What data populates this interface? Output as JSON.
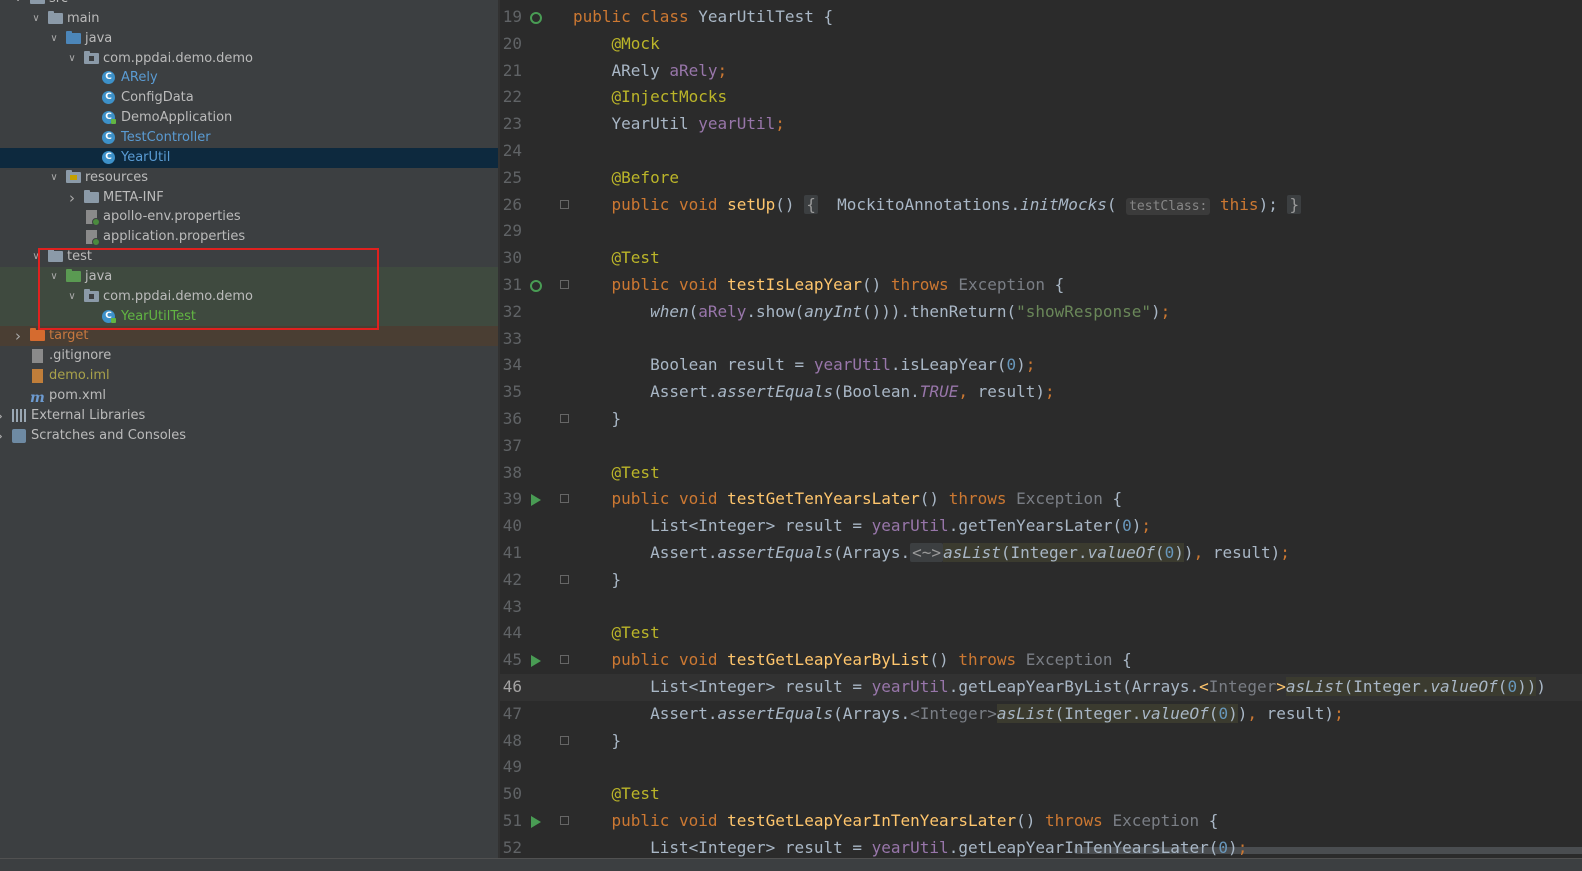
{
  "project_tree": {
    "items": [
      {
        "label": "src",
        "depth": 2,
        "icon": "folder-icon",
        "expanded": true,
        "style": ""
      },
      {
        "label": "main",
        "depth": 3,
        "icon": "folder-icon",
        "expanded": true,
        "style": ""
      },
      {
        "label": "java",
        "depth": 4,
        "icon": "source-folder-icon",
        "expanded": true,
        "style": ""
      },
      {
        "label": "com.ppdai.demo.demo",
        "depth": 5,
        "icon": "package-icon",
        "expanded": true,
        "style": ""
      },
      {
        "label": "ARely",
        "depth": 6,
        "icon": "class-icon",
        "style": "blue"
      },
      {
        "label": "ConfigData",
        "depth": 6,
        "icon": "class-icon",
        "style": ""
      },
      {
        "label": "DemoApplication",
        "depth": 6,
        "icon": "runnable-class-icon",
        "style": ""
      },
      {
        "label": "TestController",
        "depth": 6,
        "icon": "class-icon",
        "style": "blue"
      },
      {
        "label": "YearUtil",
        "depth": 6,
        "icon": "class-icon",
        "style": "blue",
        "selected": true
      },
      {
        "label": "resources",
        "depth": 4,
        "icon": "resources-folder-icon",
        "expanded": true,
        "style": ""
      },
      {
        "label": "META-INF",
        "depth": 5,
        "icon": "folder-icon",
        "expanded": false,
        "style": ""
      },
      {
        "label": "apollo-env.properties",
        "depth": 5,
        "icon": "properties-file-icon",
        "style": ""
      },
      {
        "label": "application.properties",
        "depth": 5,
        "icon": "properties-file-icon",
        "style": ""
      },
      {
        "label": "test",
        "depth": 3,
        "icon": "folder-icon",
        "expanded": true,
        "style": ""
      },
      {
        "label": "java",
        "depth": 4,
        "icon": "test-source-folder-icon",
        "expanded": true,
        "style": "",
        "test": true
      },
      {
        "label": "com.ppdai.demo.demo",
        "depth": 5,
        "icon": "package-icon",
        "expanded": true,
        "style": "",
        "test": true
      },
      {
        "label": "YearUtilTest",
        "depth": 6,
        "icon": "runnable-class-icon",
        "style": "grn",
        "test": true
      },
      {
        "label": "target",
        "depth": 2,
        "icon": "excluded-folder-icon",
        "expanded": false,
        "style": "org",
        "target": true
      },
      {
        "label": ".gitignore",
        "depth": 2,
        "icon": "file-icon",
        "style": ""
      },
      {
        "label": "demo.iml",
        "depth": 2,
        "icon": "iml-file-icon",
        "style": "yel"
      },
      {
        "label": "pom.xml",
        "depth": 2,
        "icon": "maven-icon",
        "style": ""
      },
      {
        "label": "External Libraries",
        "depth": 1,
        "icon": "libraries-icon",
        "expanded": false,
        "style": ""
      },
      {
        "label": "Scratches and Consoles",
        "depth": 1,
        "icon": "scratches-icon",
        "expanded": false,
        "style": ""
      }
    ]
  },
  "editor": {
    "current_line": "46",
    "lines": [
      {
        "n": "19",
        "gutter": "run-class",
        "segs": [
          [
            "k",
            "public class "
          ],
          [
            "",
            "YearUtilTest {"
          ]
        ]
      },
      {
        "n": "20",
        "segs": [
          [
            "",
            "    "
          ],
          [
            "a",
            "@Mock"
          ]
        ]
      },
      {
        "n": "21",
        "segs": [
          [
            "",
            "    ARely "
          ],
          [
            "f",
            "aRely"
          ],
          [
            "k",
            ";"
          ]
        ]
      },
      {
        "n": "22",
        "segs": [
          [
            "",
            "    "
          ],
          [
            "a",
            "@InjectMocks"
          ]
        ]
      },
      {
        "n": "23",
        "segs": [
          [
            "",
            "    YearUtil "
          ],
          [
            "f",
            "yearUtil"
          ],
          [
            "k",
            ";"
          ]
        ]
      },
      {
        "n": "24",
        "segs": []
      },
      {
        "n": "25",
        "segs": [
          [
            "",
            "    "
          ],
          [
            "a",
            "@Before"
          ]
        ]
      },
      {
        "n": "26",
        "fold": true,
        "segs": [
          [
            "",
            "    "
          ],
          [
            "k",
            "public void "
          ],
          [
            "fn",
            "setUp"
          ],
          [
            "",
            "() "
          ],
          [
            "fl",
            "{"
          ],
          [
            "",
            "  MockitoAnnotations."
          ],
          [
            "i",
            "initMocks"
          ],
          [
            "",
            "( "
          ],
          [
            "hint",
            "testClass:"
          ],
          [
            "k",
            " this"
          ],
          [
            "",
            "); "
          ],
          [
            "fl",
            "}"
          ]
        ]
      },
      {
        "n": "29",
        "segs": []
      },
      {
        "n": "30",
        "segs": [
          [
            "",
            "    "
          ],
          [
            "a",
            "@Test"
          ]
        ]
      },
      {
        "n": "31",
        "gutter": "run-class",
        "fold": true,
        "segs": [
          [
            "",
            "    "
          ],
          [
            "k",
            "public void "
          ],
          [
            "fn",
            "testIsLeapYear"
          ],
          [
            "",
            "() "
          ],
          [
            "k",
            "throws "
          ],
          [
            "mt",
            "Exception"
          ],
          [
            "",
            ""
          ],
          [
            "",
            ""
          ],
          [
            "",
            " {"
          ]
        ]
      },
      {
        "n": "32",
        "segs": [
          [
            "",
            "        "
          ],
          [
            "i",
            "when"
          ],
          [
            "",
            "("
          ],
          [
            "f",
            "aRely"
          ],
          [
            "",
            ".show("
          ],
          [
            "i",
            "anyInt"
          ],
          [
            "",
            "())).thenReturn("
          ],
          [
            "s",
            "\"showResponse\""
          ],
          [
            "",
            ")"
          ],
          [
            "k",
            ";"
          ]
        ]
      },
      {
        "n": "33",
        "segs": []
      },
      {
        "n": "34",
        "segs": [
          [
            "",
            "        Boolean result = "
          ],
          [
            "f",
            "yearUtil"
          ],
          [
            "",
            ".isLeapYear("
          ],
          [
            "n",
            "0"
          ],
          [
            "",
            ")"
          ],
          [
            "k",
            ";"
          ]
        ]
      },
      {
        "n": "35",
        "segs": [
          [
            "",
            "        Assert."
          ],
          [
            "i",
            "assertEquals"
          ],
          [
            "",
            "(Boolean."
          ],
          [
            "ic",
            "TRUE"
          ],
          [
            "k",
            ", "
          ],
          [
            "",
            "result)"
          ],
          [
            "k",
            ";"
          ]
        ]
      },
      {
        "n": "36",
        "fold": true,
        "segs": [
          [
            "",
            "    }"
          ]
        ]
      },
      {
        "n": "37",
        "segs": []
      },
      {
        "n": "38",
        "segs": [
          [
            "",
            "    "
          ],
          [
            "a",
            "@Test"
          ]
        ]
      },
      {
        "n": "39",
        "gutter": "run",
        "fold": true,
        "segs": [
          [
            "",
            "    "
          ],
          [
            "k",
            "public void "
          ],
          [
            "fn",
            "testGetTenYearsLater"
          ],
          [
            "",
            "() "
          ],
          [
            "k",
            "throws "
          ],
          [
            "mt",
            "Exception"
          ],
          [
            "",
            " {"
          ]
        ]
      },
      {
        "n": "40",
        "segs": [
          [
            "",
            "        List<Integer> result = "
          ],
          [
            "f",
            "yearUtil"
          ],
          [
            "",
            ".getTenYearsLater("
          ],
          [
            "n",
            "0"
          ],
          [
            "",
            ")"
          ],
          [
            "k",
            ";"
          ]
        ]
      },
      {
        "n": "41",
        "segs": [
          [
            "",
            "        Assert."
          ],
          [
            "i",
            "assertEquals"
          ],
          [
            "",
            "(Arrays."
          ],
          [
            "fl",
            "<~>"
          ],
          [
            "hlb-i",
            "asList"
          ],
          [
            "hlb",
            "(Integer."
          ],
          [
            "hlb-i",
            "valueOf"
          ],
          [
            "hlb",
            "("
          ],
          [
            "hlb-n",
            "0"
          ],
          [
            "hlb",
            ")"
          ],
          [
            "",
            ")"
          ],
          [
            "k",
            ", "
          ],
          [
            "",
            "result)"
          ],
          [
            "k",
            ";"
          ]
        ]
      },
      {
        "n": "42",
        "fold": true,
        "segs": [
          [
            "",
            "    }"
          ]
        ]
      },
      {
        "n": "43",
        "segs": []
      },
      {
        "n": "44",
        "segs": [
          [
            "",
            "    "
          ],
          [
            "a",
            "@Test"
          ]
        ]
      },
      {
        "n": "45",
        "gutter": "run",
        "fold": true,
        "segs": [
          [
            "",
            "    "
          ],
          [
            "k",
            "public void "
          ],
          [
            "fn",
            "testGetLeapYearByList"
          ],
          [
            "",
            "() "
          ],
          [
            "k",
            "throws "
          ],
          [
            "mt",
            "Exception"
          ],
          [
            "",
            " {"
          ]
        ]
      },
      {
        "n": "46",
        "segs": [
          [
            "",
            "        List<Integer> result = "
          ],
          [
            "f",
            "yearUtil"
          ],
          [
            "",
            ".getLeapYearByList(Arrays."
          ],
          [
            "fn",
            "<"
          ],
          [
            "mt",
            "Integer"
          ],
          [
            "fn",
            ">"
          ],
          [
            "hlb-i",
            "asList"
          ],
          [
            "hlb",
            "(Integer."
          ],
          [
            "hlb-i",
            "valueOf"
          ],
          [
            "hlb",
            "("
          ],
          [
            "hlb-n",
            "0"
          ],
          [
            "hlb",
            "))"
          ],
          [
            "",
            ")"
          ]
        ]
      },
      {
        "n": "47",
        "segs": [
          [
            "",
            "        Assert."
          ],
          [
            "i",
            "assertEquals"
          ],
          [
            "",
            "(Arrays."
          ],
          [
            "mt",
            "<Integer>"
          ],
          [
            "hlb-i",
            "asList"
          ],
          [
            "hlb",
            "(Integer."
          ],
          [
            "hlb-i",
            "valueOf"
          ],
          [
            "hlb",
            "("
          ],
          [
            "hlb-n",
            "0"
          ],
          [
            "hlb",
            ")"
          ],
          [
            "",
            ")"
          ],
          [
            "k",
            ", "
          ],
          [
            "",
            "result)"
          ],
          [
            "k",
            ";"
          ]
        ]
      },
      {
        "n": "48",
        "fold": true,
        "segs": [
          [
            "",
            "    }"
          ]
        ]
      },
      {
        "n": "49",
        "segs": []
      },
      {
        "n": "50",
        "segs": [
          [
            "",
            "    "
          ],
          [
            "a",
            "@Test"
          ]
        ]
      },
      {
        "n": "51",
        "gutter": "run",
        "fold": true,
        "segs": [
          [
            "",
            "    "
          ],
          [
            "k",
            "public void "
          ],
          [
            "fn",
            "testGetLeapYearInTenYearsLater"
          ],
          [
            "",
            "() "
          ],
          [
            "k",
            "throws "
          ],
          [
            "mt",
            "Exception"
          ],
          [
            "",
            " {"
          ]
        ]
      },
      {
        "n": "52",
        "segs": [
          [
            "",
            "        List<Integer> result = "
          ],
          [
            "f",
            "yearUtil"
          ],
          [
            "",
            ".getLeapYearInTenYearsLater("
          ],
          [
            "n",
            "0"
          ],
          [
            "",
            ")"
          ],
          [
            "k",
            ";"
          ]
        ]
      }
    ]
  }
}
